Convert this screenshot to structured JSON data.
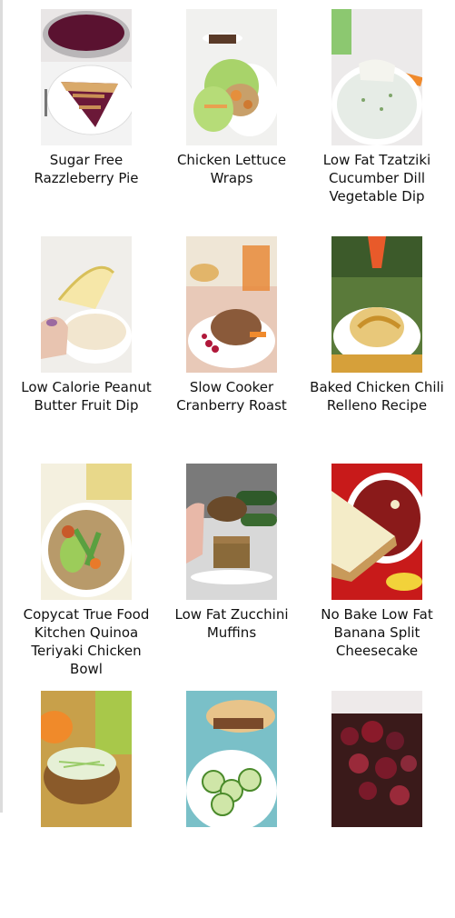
{
  "recipes": [
    {
      "title": "Sugar Free Razzleberry Pie"
    },
    {
      "title": "Chicken Lettuce Wraps"
    },
    {
      "title": "Low Fat Tzatziki Cucumber Dill Vegetable Dip"
    },
    {
      "title": "Low Calorie Peanut Butter Fruit Dip"
    },
    {
      "title": "Slow Cooker Cranberry Roast"
    },
    {
      "title": "Baked Chicken Chili Relleno Recipe"
    },
    {
      "title": "Copycat True Food Kitchen Quinoa Teriyaki Chicken Bowl"
    },
    {
      "title": "Low Fat Zucchini Muffins"
    },
    {
      "title": "No Bake Low Fat Banana Split Cheesecake"
    },
    {
      "title": ""
    },
    {
      "title": ""
    },
    {
      "title": ""
    }
  ]
}
